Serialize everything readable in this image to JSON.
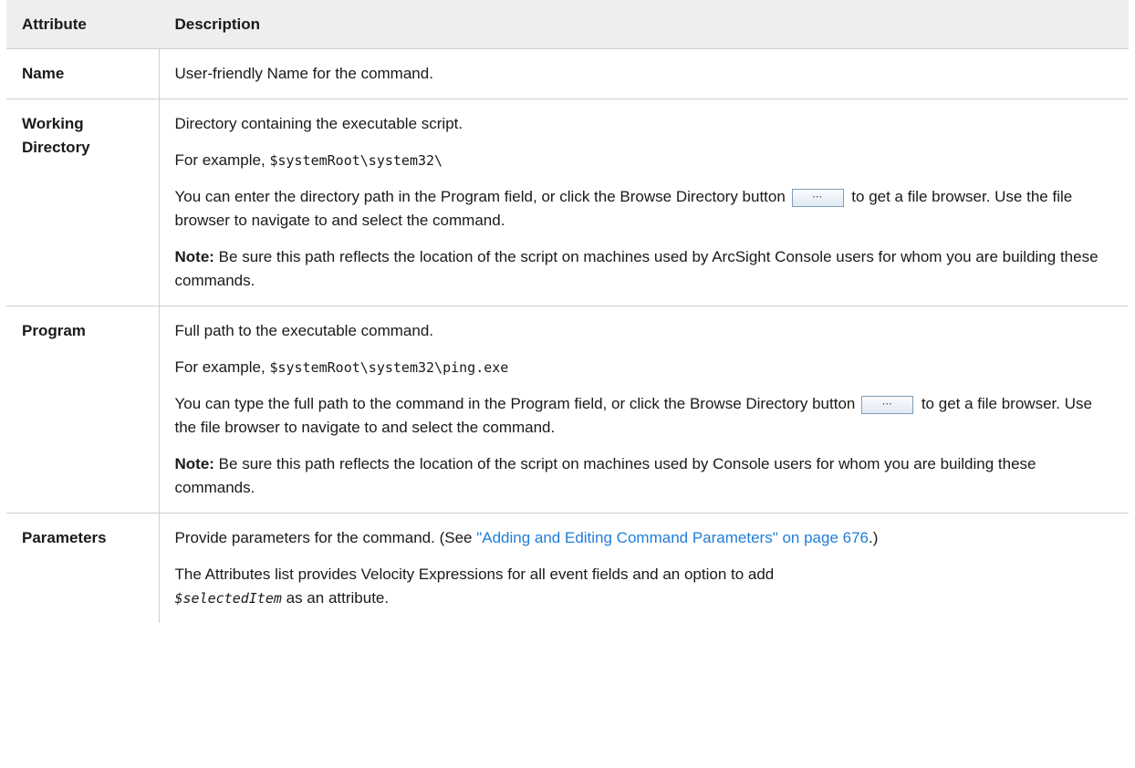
{
  "table": {
    "headers": [
      "Attribute",
      "Description"
    ],
    "rows": {
      "name": {
        "attribute": "Name",
        "desc": "User-friendly Name for the command."
      },
      "working_directory": {
        "attribute_line1": "Working",
        "attribute_line2": "Directory",
        "p1": "Directory containing the executable script.",
        "p2_prefix": "For example, ",
        "p2_code": "$systemRoot\\system32\\",
        "p3_before": "You can enter the directory path in the Program field, or click the Browse Directory button",
        "p3_after": "to get a file browser. Use the file browser to navigate to and select the command.",
        "note_label": "Note:",
        "note_text": " Be sure this path reflects the location of the script on machines used by ArcSight Console users for whom you are building these commands."
      },
      "program": {
        "attribute": "Program",
        "p1": "Full path to the executable command.",
        "p2_prefix": "For example, ",
        "p2_code": "$systemRoot\\system32\\ping.exe",
        "p3_before": "You can type the full path to the command in the Program field, or click the Browse Directory button",
        "p3_after": " to get a file browser. Use the file browser to navigate to and select the command.",
        "note_label": "Note:",
        "note_text": " Be sure this path reflects the location of the script on machines used by Console users for whom you are building these commands."
      },
      "parameters": {
        "attribute": "Parameters",
        "p1_before": "Provide parameters for the command. (See ",
        "p1_link": "\"Adding and Editing Command Parameters\" on page 676",
        "p1_after": ".)",
        "p2_before": "The Attributes list provides Velocity Expressions for all event fields and an option to add ",
        "p2_code": "$selectedItem",
        "p2_after": " as an attribute."
      }
    },
    "browse_button_label": "⋯"
  }
}
